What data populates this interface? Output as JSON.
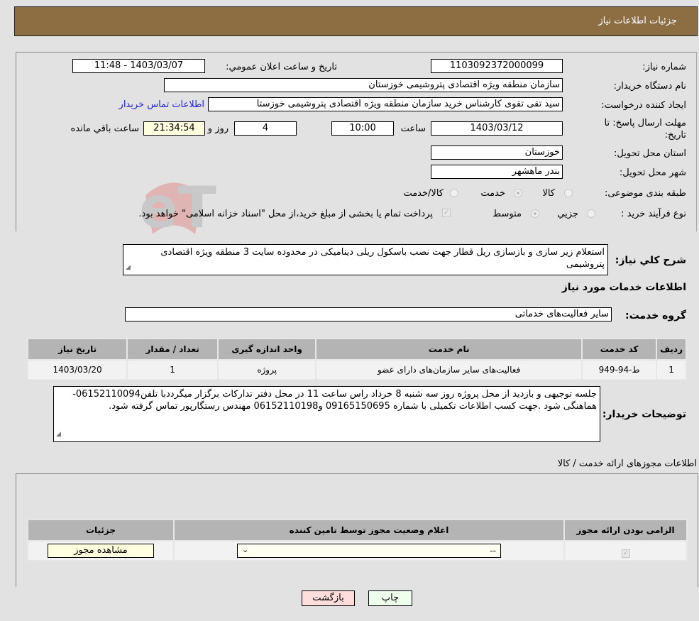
{
  "header": {
    "title": "جزئیات اطلاعات نیاز"
  },
  "form": {
    "need_number": {
      "label": "شماره نیاز:",
      "value": "1103092372000099"
    },
    "announce_datetime": {
      "label": "تاریخ و ساعت اعلان عمومي:",
      "value": "1403/03/07 - 11:48"
    },
    "buyer_org": {
      "label": "نام دستگاه خریدار:",
      "value": "سازمان منطقه ویژه اقتصادی پتروشیمی خوزستان"
    },
    "requester": {
      "label": "ایجاد کننده درخواست:",
      "value": "سید تقی تقوی کارشناس خرید سازمان منطقه ویژه اقتصادی پتروشیمی خوزستا",
      "link": "اطلاعات تماس خریدار"
    },
    "deadline": {
      "label": "مهلت ارسال پاسخ: تا تاریخ:",
      "date": "1403/03/12",
      "time_label": "ساعت",
      "time": "10:00",
      "days": "4",
      "days_label": "روز و",
      "remaining": "21:34:54",
      "remaining_label": "ساعت باقي مانده"
    },
    "province": {
      "label": "استان محل تحویل:",
      "value": "خوزستان"
    },
    "city": {
      "label": "شهر محل تحویل:",
      "value": "بندر ماهشهر"
    },
    "category": {
      "label": "طبقه بندی موضوعی:",
      "options": [
        "کالا",
        "خدمت",
        "کالا/خدمت"
      ],
      "selected": "خدمت"
    },
    "purchase_type": {
      "label": "نوع فرآیند خرید :",
      "options": [
        "جزيي",
        "متوسط"
      ],
      "selected": "متوسط",
      "treasury_note": "پرداخت تمام یا بخشی از مبلغ خرید،از محل \"اسناد خزانه اسلامی\" خواهد بود."
    }
  },
  "summary": {
    "label": "شرح کلي نياز:",
    "value": "استعلام زیر سازی و بازسازی ریل قطار جهت نصب باسکول ریلی دینامیکی در محدوده سایت 3 منطقه ویژه اقتصادی پتروشیمی"
  },
  "services": {
    "section_title": "اطلاعات خدمات مورد نياز",
    "group_label": "گروه خدمت:",
    "group_value": "سایر فعالیت‌های خدماتی",
    "columns": [
      "ردیف",
      "کد خدمت",
      "نام خدمت",
      "واحد اندازه گیری",
      "تعداد / مقدار",
      "تاریخ نیاز"
    ],
    "rows": [
      [
        "1",
        "ط-94-949",
        "فعالیت‌های سایر سازمان‌های دارای عضو",
        "پروژه",
        "1",
        "1403/03/20"
      ]
    ]
  },
  "buyer_notes": {
    "label": "توضیحات خریدار:",
    "value": "جلسه توجیهی و بازدید از محل پروژه روز سه شنبه 8 خرداد راس ساعت 11 در محل دفتر تدارکات برگزار میگرددبا تلفن06152110094-هماهنگی شود .جهت کسب اطلاعات تکمیلی با شماره 09165150695 و06152110198 مهندس رستگارپور تماس گرفته شود."
  },
  "permits": {
    "section_title": "اطلاعات مجوزهای ارائه خدمت / کالا",
    "columns": [
      "الزامی بودن ارائه مجوز",
      "اعلام وضعیت مجوز توسط تامین کننده",
      "جزئیات"
    ],
    "row": {
      "required_checked": true,
      "status_value": "--",
      "details_button": "مشاهده مجوز"
    }
  },
  "footer": {
    "print_label": "چاپ",
    "back_label": "بازگشت"
  },
  "colors": {
    "header_bg": "#8d6e43",
    "link": "#2323c8",
    "print_bg": "#eeffee",
    "back_bg": "#ffdddd"
  }
}
